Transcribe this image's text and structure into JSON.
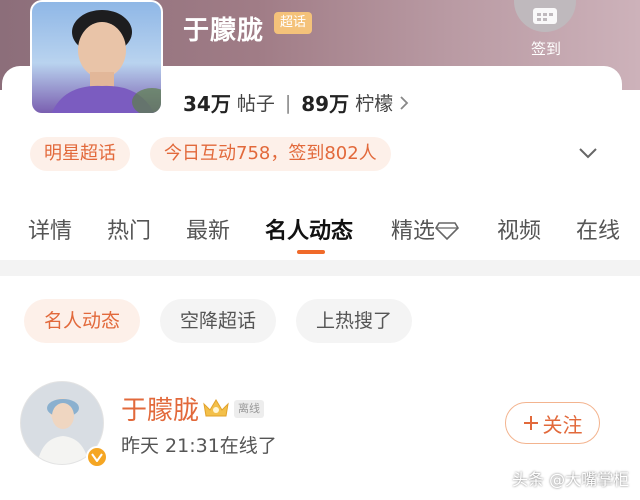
{
  "header": {
    "title": "于朦胧",
    "badge": "超话",
    "checkin_label": "签到"
  },
  "stats": {
    "posts_count": "34万",
    "posts_label": "帖子",
    "lemons_count": "89万",
    "lemons_label": "柠檬"
  },
  "pills": {
    "category": "明星超话",
    "activity": "今日互动758，签到802人"
  },
  "tabs": [
    {
      "label": "详情"
    },
    {
      "label": "热门"
    },
    {
      "label": "最新"
    },
    {
      "label": "名人动态"
    },
    {
      "label": "精选"
    },
    {
      "label": "视频"
    },
    {
      "label": "在线"
    }
  ],
  "active_tab": "名人动态",
  "subtabs": [
    {
      "label": "名人动态"
    },
    {
      "label": "空降超话"
    },
    {
      "label": "上热搜了"
    }
  ],
  "post": {
    "user_name": "于朦胧",
    "offline_tag": "离线",
    "status": "昨天 21:31在线了",
    "follow_label": "关注"
  },
  "watermark": "头条 @大嘴掌柜",
  "colors": {
    "accent": "#e2693b",
    "accent_bg": "#fdf0e9",
    "header_gradient_start": "#8c6e7a",
    "header_gradient_end": "#cdb2ba"
  }
}
